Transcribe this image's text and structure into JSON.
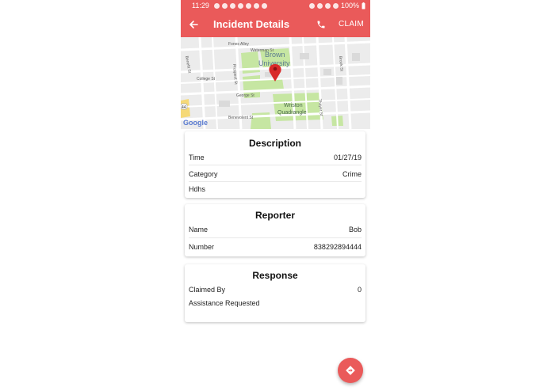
{
  "status_bar": {
    "time": "11:29",
    "battery": "100%"
  },
  "app_bar": {
    "title": "Incident Details",
    "claim_label": "CLAIM"
  },
  "map": {
    "labels": {
      "fones_alley": "Fones Alley",
      "waterman_st": "Waterman St",
      "brown_university": "Brown\nUniversity",
      "college_st": "College St",
      "benefit_st": "Benefit St",
      "prospect_st": "Prospect St",
      "brook_st": "Brook St",
      "george_st": "George St",
      "benevolent_st": "Benevolent St",
      "wriston_quadrangle": "Wriston\nQuadrangle",
      "thayer_st": "Thayer St",
      "route": "44"
    },
    "attribution": "Google"
  },
  "description": {
    "heading": "Description",
    "time_label": "Time",
    "time_value": "01/27/19",
    "category_label": "Category",
    "category_value": "Crime",
    "details": "Hdhs"
  },
  "reporter": {
    "heading": "Reporter",
    "name_label": "Name",
    "name_value": "Bob",
    "number_label": "Number",
    "number_value": "838292894444"
  },
  "response": {
    "heading": "Response",
    "claimed_by_label": "Claimed By",
    "claimed_by_value": "0",
    "assistance_label": "Assistance Requested"
  },
  "colors": {
    "primary": "#ea5a5a",
    "park": "#c6e6a2",
    "map_bg": "#ececec"
  }
}
